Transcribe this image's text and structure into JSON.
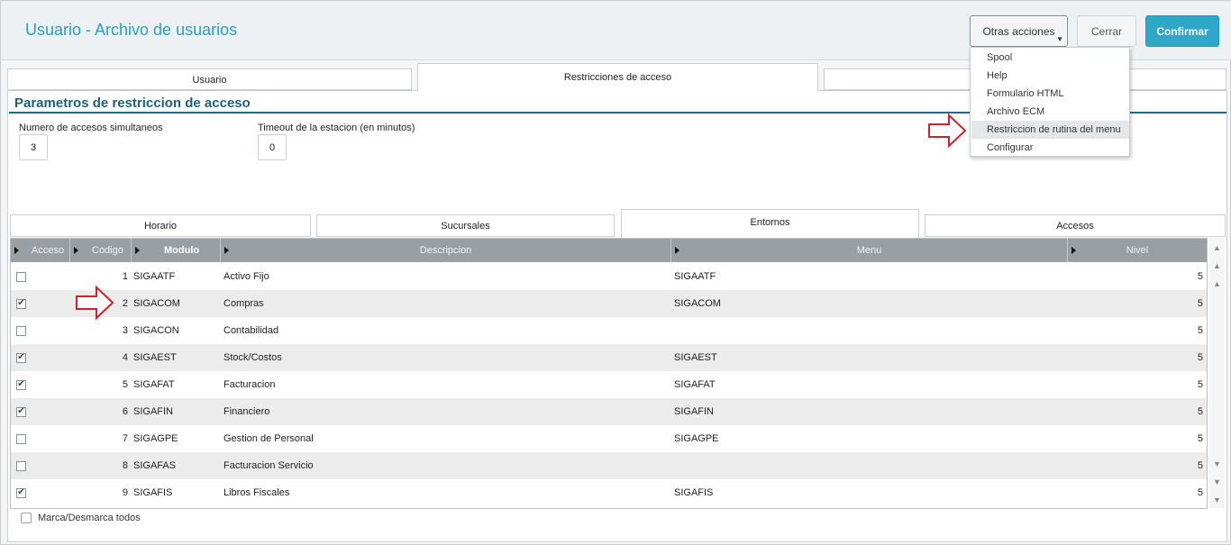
{
  "header": {
    "title": "Usuario - Archivo de usuarios",
    "otras_acciones": "Otras acciones",
    "cerrar": "Cerrar",
    "confirmar": "Confirmar"
  },
  "top_tabs": [
    "Usuario",
    "Restricciones de acceso"
  ],
  "section_title": "Parametros de restriccion de acceso",
  "fields": {
    "accesos_label": "Numero de accesos simultaneos",
    "accesos_value": "3",
    "timeout_label": "Timeout de la estacion (en minutos)",
    "timeout_value": "0"
  },
  "inner_tabs": [
    "Horario",
    "Sucursales",
    "Entornos",
    "Accesos"
  ],
  "grid": {
    "columns": [
      "Acceso",
      "Codigo",
      "Modulo",
      "Descripcion",
      "Menu",
      "Nivel"
    ],
    "rows": [
      {
        "acceso": false,
        "codigo": "1",
        "modulo": "SIGAATF",
        "descripcion": "Activo Fijo",
        "menu": "SIGAATF",
        "nivel": "5"
      },
      {
        "acceso": true,
        "codigo": "2",
        "modulo": "SIGACOM",
        "descripcion": "Compras",
        "menu": "SIGACOM",
        "nivel": "5"
      },
      {
        "acceso": false,
        "codigo": "3",
        "modulo": "SIGACON",
        "descripcion": "Contabilidad",
        "menu": "",
        "nivel": "5"
      },
      {
        "acceso": true,
        "codigo": "4",
        "modulo": "SIGAEST",
        "descripcion": "Stock/Costos",
        "menu": "SIGAEST",
        "nivel": "5"
      },
      {
        "acceso": true,
        "codigo": "5",
        "modulo": "SIGAFAT",
        "descripcion": "Facturacion",
        "menu": "SIGAFAT",
        "nivel": "5"
      },
      {
        "acceso": true,
        "codigo": "6",
        "modulo": "SIGAFIN",
        "descripcion": "Financiero",
        "menu": "SIGAFIN",
        "nivel": "5"
      },
      {
        "acceso": false,
        "codigo": "7",
        "modulo": "SIGAGPE",
        "descripcion": "Gestion de Personal",
        "menu": "SIGAGPE",
        "nivel": "5"
      },
      {
        "acceso": false,
        "codigo": "8",
        "modulo": "SIGAFAS",
        "descripcion": "Facturacion Servicio",
        "menu": "",
        "nivel": "5"
      },
      {
        "acceso": true,
        "codigo": "9",
        "modulo": "SIGAFIS",
        "descripcion": "Libros Fiscales",
        "menu": "SIGAFIS",
        "nivel": "5"
      }
    ]
  },
  "footer": {
    "marca_label": "Marca/Desmarca todos"
  },
  "dropdown": {
    "items": [
      "Spool",
      "Help",
      "Formulario HTML",
      "Archivo ECM",
      "Restriccion de rutina del menu",
      "Configurar"
    ],
    "highlighted_index": 4
  },
  "colors": {
    "accent": "#2fa7c9",
    "title": "#2a9fc3",
    "section": "#1c5f80",
    "annotation_arrow": "#d4202a"
  }
}
